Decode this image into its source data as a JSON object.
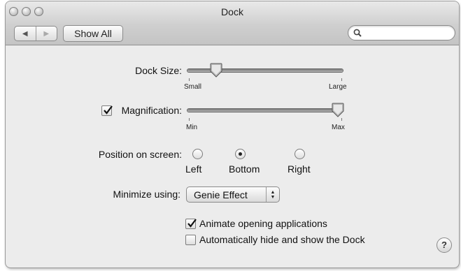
{
  "window": {
    "title": "Dock"
  },
  "toolbar": {
    "back_icon": "back-arrow-icon",
    "forward_icon": "forward-arrow-icon",
    "show_all_label": "Show All",
    "search_placeholder": "",
    "search_icon": "magnifier-icon"
  },
  "dock_size": {
    "label": "Dock Size:",
    "min_label": "Small",
    "max_label": "Large",
    "value": 0.18
  },
  "magnification": {
    "label": "Magnification:",
    "checked": true,
    "min_label": "Min",
    "max_label": "Max",
    "value": 0.98
  },
  "position": {
    "label": "Position on screen:",
    "options": [
      "Left",
      "Bottom",
      "Right"
    ],
    "selected": "Bottom"
  },
  "minimize": {
    "label": "Minimize using:",
    "selected": "Genie Effect"
  },
  "options": {
    "animate_label": "Animate opening applications",
    "animate_checked": true,
    "autohide_label": "Automatically hide and show the Dock",
    "autohide_checked": false
  },
  "help": {
    "label": "?"
  },
  "colors": {
    "window_bg": "#ececec",
    "titlebar_bg": "#cfcfcf"
  }
}
